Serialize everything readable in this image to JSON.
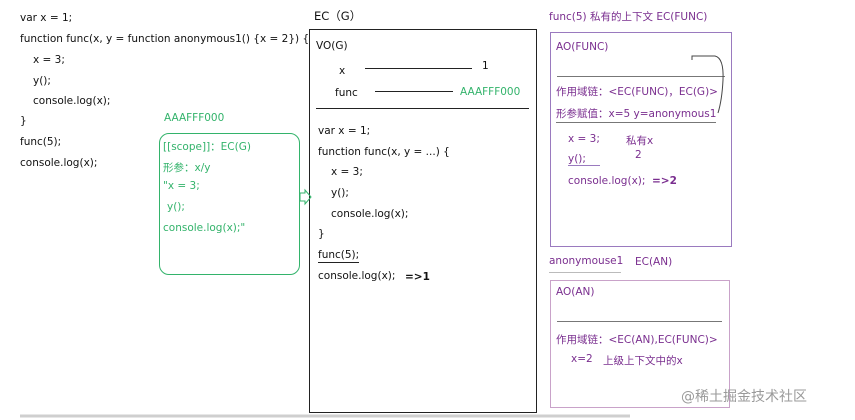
{
  "left_code": {
    "lines": [
      "var x = 1;",
      "function func(x, y = function anonymous1() {x = 2}) {",
      "x = 3;",
      "y();",
      "console.log(x);",
      "}",
      "func(5);",
      "console.log(x);"
    ]
  },
  "scope_box": {
    "label": "AAAFFF000",
    "lines": [
      "[[scope]]：EC(G)",
      "形参：x/y",
      "\"x = 3;",
      "y();",
      "console.log(x);\""
    ]
  },
  "ec_g": {
    "title": "EC（G）",
    "vo_label": "VO(G)",
    "x_label": "x",
    "x_value": "1",
    "func_label": "func",
    "func_value": "AAAFFF000",
    "code_lines": [
      "var x = 1;",
      "function func(x, y = ...) {",
      "x = 3;",
      "y();",
      "console.log(x);",
      "}",
      "func(5);",
      "console.log(x);"
    ],
    "result": "=>1"
  },
  "func_ctx": {
    "title": "func(5)  私有的上下文  EC(FUNC)",
    "ao_label": "AO(FUNC)",
    "scope_chain": "作用域链：<EC(FUNC)，EC(G)>",
    "params": "形参赋值：x=5   y=anonymous1",
    "line1": "x = 3;",
    "note1": "私有x",
    "line2": "y();",
    "note2": "2",
    "line3": "console.log(x);",
    "result": "=>2"
  },
  "anon_ctx": {
    "title": "anonymouse1",
    "title_ec": "EC(AN)",
    "ao_label": "AO(AN)",
    "scope_chain": "作用域链：<EC(AN),EC(FUNC)>",
    "line1": "x=2",
    "note1": "上级上下文中的x"
  },
  "watermark": "@稀土掘金技术社区",
  "colors": {
    "green": "#33b36b",
    "purple": "#7a2e8f",
    "box_purple": "#9a7abf",
    "box_pink": "#c9a2c9"
  }
}
